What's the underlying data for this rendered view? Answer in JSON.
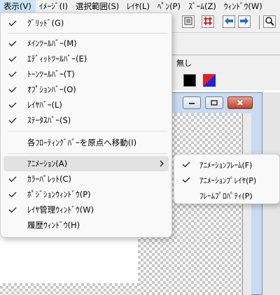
{
  "menubar": {
    "items": [
      "表示(V)",
      "ｲﾒｰｼﾞ(I)",
      "選択範囲(S)",
      "ﾚｲﾔ(L)",
      "ﾍﾟﾝ(P)",
      "ｽﾞｰﾑ(Z)",
      "ｳｨﾝﾄﾞｳ(W)"
    ]
  },
  "background_window": {
    "palette_text": "無し",
    "colors": {
      "primary": "#000000",
      "swatch_red": "#e02020",
      "swatch_blue": "#2020e0"
    }
  },
  "view_menu": {
    "items": [
      {
        "label": "ｸﾞﾘｯﾄﾞ(G)",
        "checked": true
      },
      {
        "label": "ﾒｲﾝﾂｰﾙﾊﾞｰ(M)",
        "checked": true
      },
      {
        "label": "ｴﾃﾞｨｯﾄﾂｰﾙﾊﾞｰ(E)",
        "checked": true
      },
      {
        "label": "ﾄｰﾝﾂｰﾙﾊﾞｰ(T)",
        "checked": true
      },
      {
        "label": "ｵﾌﾟｼｮﾝﾊﾞｰ(O)",
        "checked": true
      },
      {
        "label": "ﾚｲﾔﾊﾞｰ(L)",
        "checked": true
      },
      {
        "label": "ｽﾃｰﾀｽﾊﾞｰ(S)",
        "checked": true
      },
      {
        "label": "各ﾌﾛｰﾃｨﾝｸﾞﾊﾞｰを原点へ移動(I)",
        "checked": false
      },
      {
        "label": "ｱﾆﾒｰｼｮﾝ(A)",
        "checked": false,
        "submenu": true
      },
      {
        "label": "ｶﾗｰﾊﾟﾚｯﾄ(C)",
        "checked": true
      },
      {
        "label": "ﾎﾟｼﾞｼｮﾝｳｨﾝﾄﾞｳ(P)",
        "checked": true
      },
      {
        "label": "ﾚｲﾔ管理ｳｨﾝﾄﾞｳ(W)",
        "checked": true
      },
      {
        "label": "履歴ｳｨﾝﾄﾞｳ(H)",
        "checked": false
      }
    ]
  },
  "animation_submenu": {
    "items": [
      {
        "label": "ｱﾆﾒｰｼｮﾝﾌﾚｰﾑ(F)",
        "checked": true
      },
      {
        "label": "ｱﾆﾒｰｼｮﾝﾌﾟﾚｲﾔ(P)",
        "checked": true
      },
      {
        "label": "ﾌﾚｰﾑﾌﾟﾛﾊﾟﾃｨ(P)",
        "checked": false
      }
    ]
  }
}
